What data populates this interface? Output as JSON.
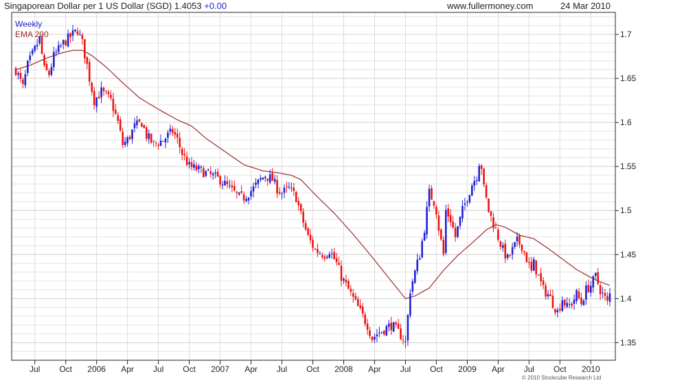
{
  "header": {
    "title": "Singaporean Dollar per 1 US Dollar (SGD)",
    "last": "1.4053",
    "change": "+0.00",
    "site": "www.fullermoney.com",
    "date": "24 Mar 2010"
  },
  "footer": {
    "copyright": "© 2010 Stockcube Research Ltd"
  },
  "colors": {
    "up": "#1f1fd6",
    "down": "#ee1111",
    "ema": "#9b2c2c",
    "grid": "#d4d4d4",
    "axis": "#222222"
  },
  "chart_data": {
    "type": "candlestick",
    "period": "Weekly",
    "start_week": "2005-05-06",
    "ylim": [
      1.33,
      1.725
    ],
    "yticks": [
      1.35,
      1.4,
      1.45,
      1.5,
      1.55,
      1.6,
      1.65,
      1.7
    ],
    "ytick_labels": [
      "1.35",
      "1.4",
      "1.45",
      "1.5",
      "1.55",
      "1.6",
      "1.65",
      "1.7"
    ],
    "xticks": [
      {
        "label": "Jul",
        "week": 8
      },
      {
        "label": "Oct",
        "week": 21
      },
      {
        "label": "2006",
        "week": 34
      },
      {
        "label": "Apr",
        "week": 47
      },
      {
        "label": "Jul",
        "week": 60
      },
      {
        "label": "Oct",
        "week": 73
      },
      {
        "label": "2007",
        "week": 86
      },
      {
        "label": "Apr",
        "week": 99
      },
      {
        "label": "Jul",
        "week": 112
      },
      {
        "label": "Oct",
        "week": 125
      },
      {
        "label": "2008",
        "week": 138
      },
      {
        "label": "Apr",
        "week": 151
      },
      {
        "label": "Jul",
        "week": 164
      },
      {
        "label": "Oct",
        "week": 177
      },
      {
        "label": "2009",
        "week": 190
      },
      {
        "label": "Apr",
        "week": 203
      },
      {
        "label": "Jul",
        "week": 216
      },
      {
        "label": "Oct",
        "week": 229
      },
      {
        "label": "2010",
        "week": 242
      }
    ],
    "series": [
      {
        "name": "Weekly",
        "kind": "price"
      },
      {
        "name": "EMA 200",
        "kind": "ema"
      }
    ],
    "close_anchors": [
      [
        0,
        1.66
      ],
      [
        3,
        1.64
      ],
      [
        5,
        1.665
      ],
      [
        10,
        1.695
      ],
      [
        12,
        1.66
      ],
      [
        14,
        1.655
      ],
      [
        16,
        1.675
      ],
      [
        20,
        1.69
      ],
      [
        22,
        1.695
      ],
      [
        26,
        1.705
      ],
      [
        28,
        1.69
      ],
      [
        30,
        1.665
      ],
      [
        31,
        1.65
      ],
      [
        33,
        1.625
      ],
      [
        36,
        1.635
      ],
      [
        40,
        1.625
      ],
      [
        43,
        1.6
      ],
      [
        45,
        1.575
      ],
      [
        47,
        1.58
      ],
      [
        50,
        1.595
      ],
      [
        53,
        1.6
      ],
      [
        55,
        1.585
      ],
      [
        58,
        1.575
      ],
      [
        62,
        1.58
      ],
      [
        66,
        1.59
      ],
      [
        68,
        1.58
      ],
      [
        70,
        1.565
      ],
      [
        73,
        1.55
      ],
      [
        78,
        1.545
      ],
      [
        82,
        1.54
      ],
      [
        86,
        1.535
      ],
      [
        90,
        1.525
      ],
      [
        94,
        1.515
      ],
      [
        96,
        1.515
      ],
      [
        100,
        1.525
      ],
      [
        103,
        1.535
      ],
      [
        105,
        1.54
      ],
      [
        108,
        1.535
      ],
      [
        110,
        1.525
      ],
      [
        112,
        1.52
      ],
      [
        115,
        1.525
      ],
      [
        118,
        1.515
      ],
      [
        120,
        1.495
      ],
      [
        123,
        1.47
      ],
      [
        126,
        1.455
      ],
      [
        130,
        1.45
      ],
      [
        132,
        1.455
      ],
      [
        135,
        1.44
      ],
      [
        137,
        1.425
      ],
      [
        140,
        1.41
      ],
      [
        143,
        1.395
      ],
      [
        146,
        1.38
      ],
      [
        148,
        1.37
      ],
      [
        150,
        1.355
      ],
      [
        152,
        1.36
      ],
      [
        155,
        1.365
      ],
      [
        158,
        1.37
      ],
      [
        160,
        1.365
      ],
      [
        163,
        1.355
      ],
      [
        164,
        1.35
      ],
      [
        165,
        1.38
      ],
      [
        166,
        1.41
      ],
      [
        168,
        1.43
      ],
      [
        170,
        1.45
      ],
      [
        172,
        1.48
      ],
      [
        173,
        1.5
      ],
      [
        174,
        1.52
      ],
      [
        176,
        1.51
      ],
      [
        177,
        1.5
      ],
      [
        178,
        1.48
      ],
      [
        180,
        1.45
      ],
      [
        181,
        1.5
      ],
      [
        183,
        1.49
      ],
      [
        185,
        1.47
      ],
      [
        186,
        1.48
      ],
      [
        188,
        1.5
      ],
      [
        190,
        1.515
      ],
      [
        192,
        1.53
      ],
      [
        194,
        1.54
      ],
      [
        195,
        1.555
      ],
      [
        196,
        1.55
      ],
      [
        197,
        1.525
      ],
      [
        199,
        1.5
      ],
      [
        201,
        1.485
      ],
      [
        203,
        1.47
      ],
      [
        205,
        1.455
      ],
      [
        207,
        1.445
      ],
      [
        209,
        1.455
      ],
      [
        211,
        1.465
      ],
      [
        213,
        1.46
      ],
      [
        215,
        1.445
      ],
      [
        217,
        1.43
      ],
      [
        218,
        1.44
      ],
      [
        220,
        1.425
      ],
      [
        222,
        1.41
      ],
      [
        224,
        1.405
      ],
      [
        226,
        1.395
      ],
      [
        228,
        1.385
      ],
      [
        230,
        1.4
      ],
      [
        232,
        1.39
      ],
      [
        234,
        1.395
      ],
      [
        236,
        1.405
      ],
      [
        238,
        1.395
      ],
      [
        240,
        1.41
      ],
      [
        242,
        1.415
      ],
      [
        244,
        1.425
      ],
      [
        246,
        1.41
      ],
      [
        248,
        1.4
      ],
      [
        249,
        1.395
      ],
      [
        250,
        1.405
      ]
    ],
    "ema_anchors": [
      [
        0,
        1.66
      ],
      [
        6,
        1.665
      ],
      [
        12,
        1.672
      ],
      [
        18,
        1.678
      ],
      [
        24,
        1.682
      ],
      [
        28,
        1.682
      ],
      [
        32,
        1.676
      ],
      [
        38,
        1.663
      ],
      [
        45,
        1.645
      ],
      [
        52,
        1.628
      ],
      [
        60,
        1.615
      ],
      [
        68,
        1.603
      ],
      [
        74,
        1.596
      ],
      [
        80,
        1.582
      ],
      [
        88,
        1.567
      ],
      [
        96,
        1.552
      ],
      [
        104,
        1.545
      ],
      [
        110,
        1.543
      ],
      [
        116,
        1.54
      ],
      [
        120,
        1.535
      ],
      [
        126,
        1.518
      ],
      [
        134,
        1.497
      ],
      [
        142,
        1.473
      ],
      [
        150,
        1.447
      ],
      [
        158,
        1.42
      ],
      [
        164,
        1.4
      ],
      [
        168,
        1.403
      ],
      [
        174,
        1.412
      ],
      [
        180,
        1.432
      ],
      [
        186,
        1.449
      ],
      [
        192,
        1.463
      ],
      [
        198,
        1.478
      ],
      [
        202,
        1.484
      ],
      [
        206,
        1.481
      ],
      [
        212,
        1.472
      ],
      [
        218,
        1.468
      ],
      [
        224,
        1.457
      ],
      [
        230,
        1.445
      ],
      [
        236,
        1.433
      ],
      [
        242,
        1.424
      ],
      [
        246,
        1.419
      ],
      [
        250,
        1.415
      ]
    ]
  }
}
